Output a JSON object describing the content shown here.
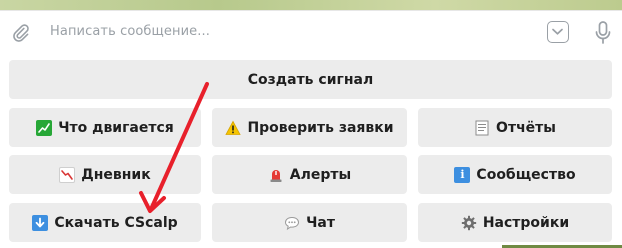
{
  "input": {
    "placeholder": "Написать сообщение..."
  },
  "colors": {
    "button_bg": "#ececec",
    "button_text": "#1f1f1f",
    "arrow": "#e8202b",
    "icon_gray": "#9aa0a6"
  },
  "icons": {
    "attach": "paperclip-icon",
    "bot_commands": "chevron-down-box-icon",
    "voice": "microphone-icon"
  },
  "keyboard": {
    "create_signal": "Создать сигнал",
    "whats_moving": "Что двигается",
    "check_orders": "Проверить заявки",
    "reports": "Отчёты",
    "journal": "Дневник",
    "alerts": "Алерты",
    "community": "Сообщество",
    "download_cscalp": "Скачать CScalp",
    "chat": "Чат",
    "settings": "Настройки"
  },
  "annotation": {
    "arrow_target": "download_cscalp"
  }
}
